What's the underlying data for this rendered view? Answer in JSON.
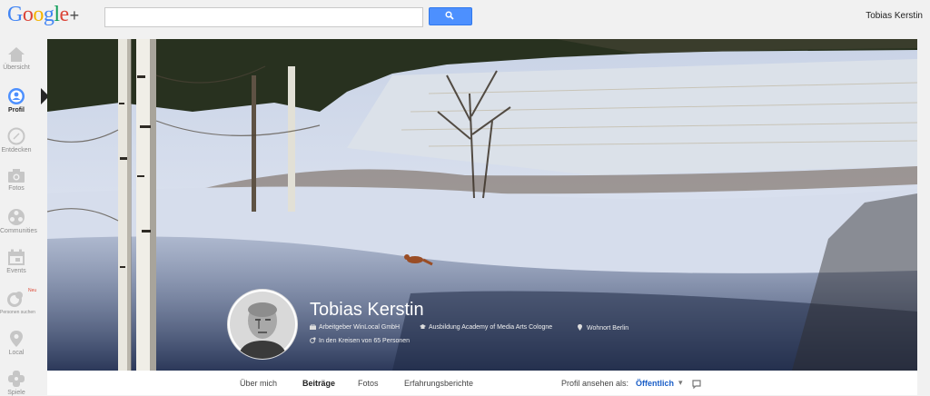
{
  "header": {
    "logo": {
      "g": "G",
      "o1": "o",
      "o2": "o",
      "g2": "g",
      "l": "l",
      "e": "e",
      "plus": "+"
    },
    "search_placeholder": "",
    "user_name": "Tobias Kerstin"
  },
  "nav": {
    "items": [
      {
        "label": "Übersicht",
        "icon": "home-icon"
      },
      {
        "label": "Profil",
        "icon": "profile-icon",
        "active": true
      },
      {
        "label": "Entdecken",
        "icon": "compass-icon"
      },
      {
        "label": "Fotos",
        "icon": "camera-icon"
      },
      {
        "label": "Communities",
        "icon": "communities-icon"
      },
      {
        "label": "Events",
        "icon": "calendar-icon"
      },
      {
        "label": "Personen suchen",
        "icon": "people-icon",
        "badge": "Neu"
      },
      {
        "label": "Local",
        "icon": "pin-icon"
      },
      {
        "label": "Spiele",
        "icon": "games-icon"
      }
    ]
  },
  "profile": {
    "name": "Tobias Kerstin",
    "employer": "Arbeitgeber WinLocal GmbH",
    "education": "Ausbildung Academy of Media Arts Cologne",
    "residence": "Wohnort Berlin",
    "circles": "In den Kreisen von 65 Personen"
  },
  "tabs": {
    "about": "Über mich",
    "posts": "Beiträge",
    "photos": "Fotos",
    "reviews": "Erfahrungsberichte",
    "view_as_label": "Profil ansehen als:",
    "view_as_value": "Öffentlich",
    "caret": "▾"
  },
  "colors": {
    "blue": "#4285f4",
    "red": "#db4437",
    "yellow": "#f4b400",
    "green": "#0f9d58",
    "link": "#1a5ec7",
    "search_button": "#4d90fe"
  }
}
